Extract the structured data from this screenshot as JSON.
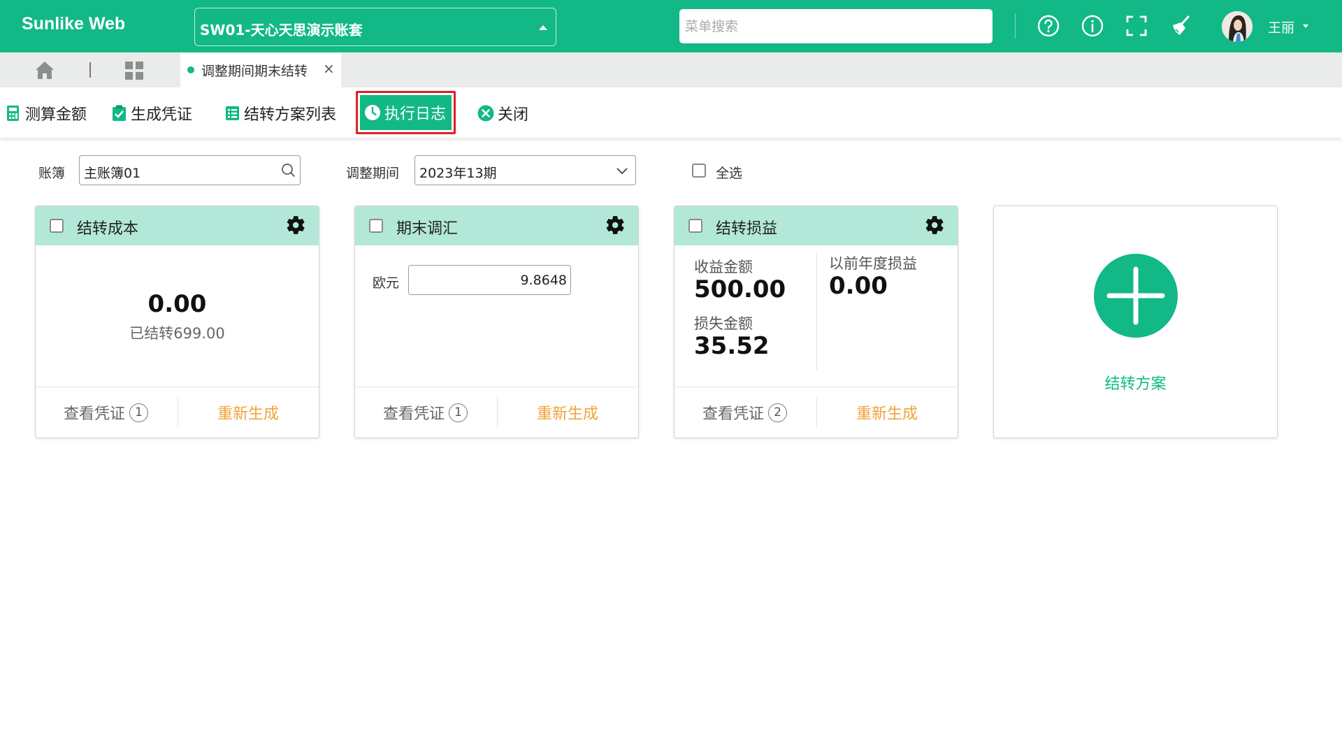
{
  "header": {
    "brand": "Sunlike Web",
    "account": "SW01-天心天思演示账套",
    "search_placeholder": "菜单搜索",
    "user_name": "王丽"
  },
  "tabs": {
    "active_label": "调整期间期末结转",
    "close_glyph": "×"
  },
  "toolbar": {
    "calc": "测算金额",
    "gen_voucher": "生成凭证",
    "scheme_list": "结转方案列表",
    "exec_log": "执行日志",
    "close": "关闭"
  },
  "filters": {
    "ledger_label": "账簿",
    "ledger_value": "主账簿01",
    "period_label": "调整期间",
    "period_value": "2023年13期",
    "select_all": "全选"
  },
  "cards": [
    {
      "title": "结转成本",
      "amount": "0.00",
      "sub": "已结转699.00",
      "view_voucher": "查看凭证",
      "voucher_count": "1",
      "regen": "重新生成"
    },
    {
      "title": "期末调汇",
      "currency_label": "欧元",
      "rate": "9.8648",
      "view_voucher": "查看凭证",
      "voucher_count": "1",
      "regen": "重新生成"
    },
    {
      "title": "结转损益",
      "income_label": "收益金额",
      "income_value": "500.00",
      "loss_label": "损失金额",
      "loss_value": "35.52",
      "prior_label": "以前年度损益",
      "prior_value": "0.00",
      "view_voucher": "查看凭证",
      "voucher_count": "2",
      "regen": "重新生成"
    }
  ],
  "add_card": {
    "label": "结转方案"
  },
  "colors": {
    "brand": "#12b886",
    "card_header": "#b3e8d8",
    "regen": "#f0a33c",
    "highlight": "#e0201f"
  },
  "icons": [
    "help-icon",
    "info-icon",
    "fullscreen-icon",
    "clean-icon",
    "home-icon",
    "apps-icon",
    "gear-icon",
    "search-icon",
    "chevron-down-icon",
    "plus-icon"
  ]
}
